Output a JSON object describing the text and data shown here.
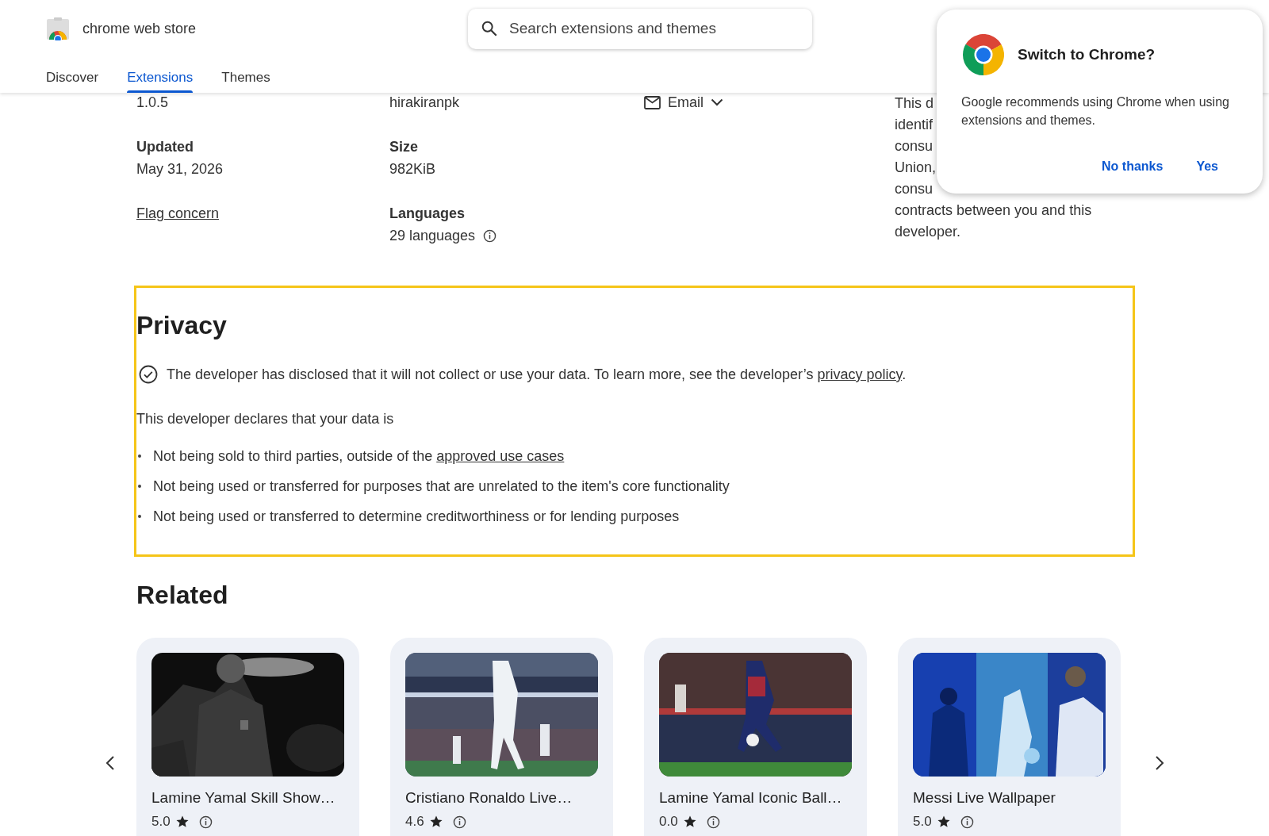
{
  "header": {
    "store_name": "chrome web store",
    "search": {
      "placeholder": "Search extensions and themes"
    },
    "tabs": [
      {
        "label": "Discover",
        "selected": false
      },
      {
        "label": "Extensions",
        "selected": true
      },
      {
        "label": "Themes",
        "selected": false
      }
    ]
  },
  "details": {
    "version": "1.0.5",
    "developer": "hirakiranpk",
    "contact": "Email",
    "updated": {
      "label": "Updated",
      "value": "May 31, 2026"
    },
    "size": {
      "label": "Size",
      "value": "982KiB"
    },
    "flag_link": "Flag concern",
    "languages": {
      "label": "Languages",
      "value": "29 languages"
    },
    "notice_lines": [
      "This d",
      "identif",
      "consu",
      "Union,",
      "consu",
      "contracts between you and this",
      "developer."
    ]
  },
  "privacy": {
    "highlighted": true,
    "title": "Privacy",
    "disclosure": {
      "text": "The developer has disclosed that it will not collect or use your data. To learn more, see the developer’s ",
      "link": "privacy policy",
      "after": "."
    },
    "declaration": "This developer declares that your data is",
    "items": [
      {
        "text": "Not being sold to third parties, outside of the ",
        "link": "approved use cases"
      },
      {
        "text": "Not being used or transferred for purposes that are unrelated to the item's core functionality"
      },
      {
        "text": "Not being used or transferred to determine creditworthiness or for lending purposes"
      }
    ]
  },
  "related": {
    "title": "Related",
    "cards": [
      {
        "title": "Lamine Yamal Skill Show…",
        "rating": "5.0"
      },
      {
        "title": "Cristiano Ronaldo Live…",
        "rating": "4.6"
      },
      {
        "title": "Lamine Yamal Iconic Ball…",
        "rating": "0.0"
      },
      {
        "title": "Messi Live Wallpaper",
        "rating": "5.0"
      }
    ]
  },
  "popup": {
    "title": "Switch to Chrome?",
    "message": "Google recommends using Chrome when using extensions and themes.",
    "buttons": [
      "No thanks",
      "Yes"
    ]
  }
}
